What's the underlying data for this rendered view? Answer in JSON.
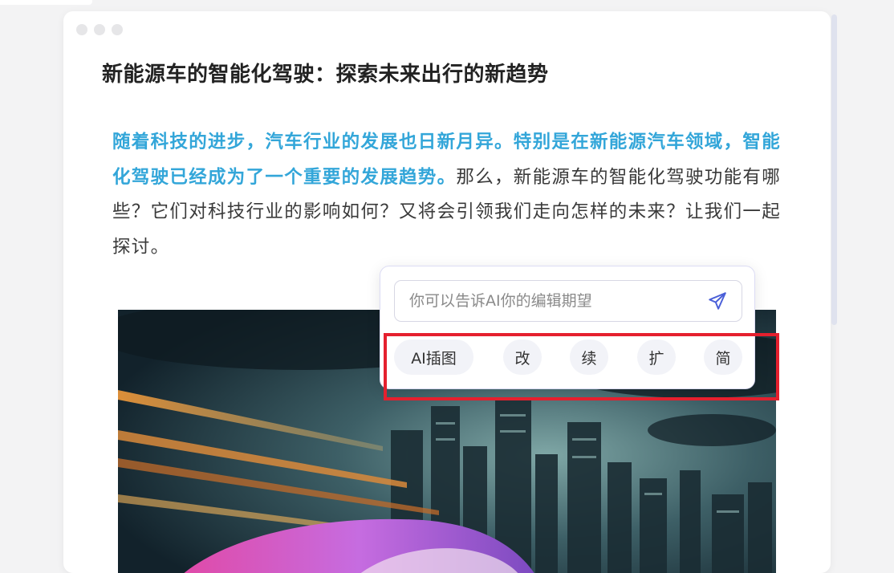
{
  "article": {
    "title": "新能源车的智能化驾驶：探索未来出行的新趋势",
    "highlight": "随着科技的进步，汽车行业的发展也日新月异。特别是在新能源汽车领域，智能化驾驶已经成为了一个重要的发展趋势。",
    "body": "那么，新能源车的智能化驾驶功能有哪些？它们对科技行业的影响如何？又将会引领我们走向怎样的未来？让我们一起探讨。"
  },
  "ai_popup": {
    "placeholder": "你可以告诉AI你的编辑期望",
    "send_icon": "send-icon",
    "actions": [
      "AI插图",
      "改",
      "续",
      "扩",
      "简"
    ]
  },
  "colors": {
    "highlight": "#33a6d9",
    "send_icon": "#4a5fd8",
    "annotation_box": "#e5202e"
  }
}
